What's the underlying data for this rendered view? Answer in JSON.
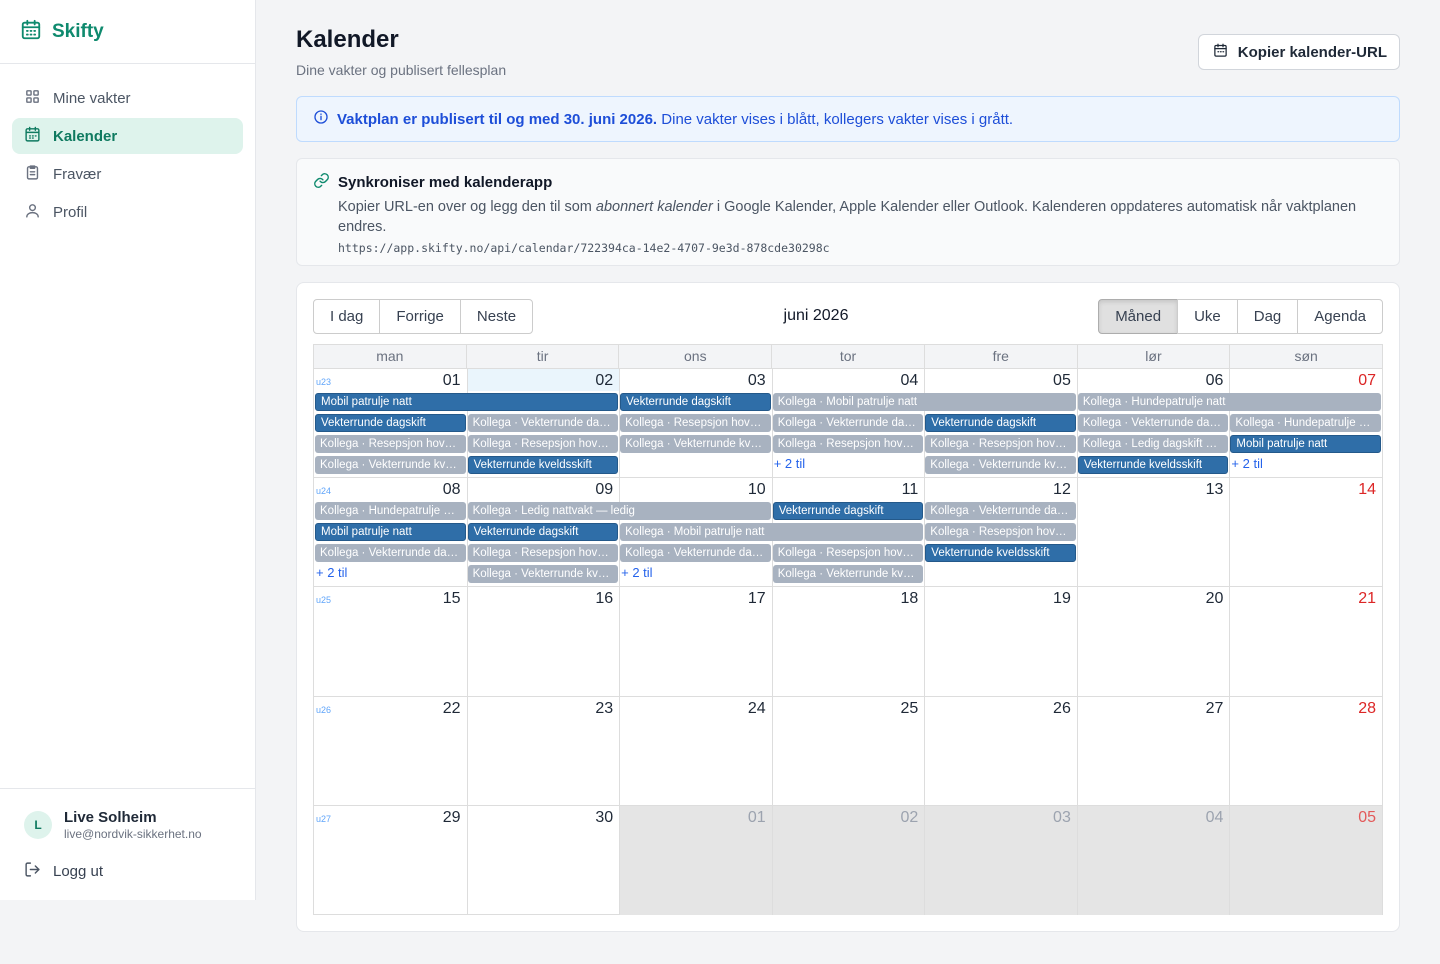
{
  "app": {
    "name": "Skifty"
  },
  "nav": [
    {
      "label": "Mine vakter",
      "icon": "grid-icon",
      "active": false
    },
    {
      "label": "Kalender",
      "icon": "calendar-icon",
      "active": true
    },
    {
      "label": "Fravær",
      "icon": "clipboard-icon",
      "active": false
    },
    {
      "label": "Profil",
      "icon": "user-icon",
      "active": false
    }
  ],
  "user": {
    "initial": "L",
    "name": "Live Solheim",
    "email": "live@nordvik-sikkerhet.no",
    "logout_label": "Logg ut"
  },
  "header": {
    "title": "Kalender",
    "subtitle": "Dine vakter og publisert fellesplan",
    "copy_button": "Kopier kalender-URL"
  },
  "info": {
    "bold": "Vaktplan er publisert til og med 30. juni 2026.",
    "text": " Dine vakter vises i blått, kollegers vakter vises i grått."
  },
  "sync": {
    "title": "Synkroniser med kalenderapp",
    "text_before": "Kopier URL-en over og legg den til som ",
    "text_em": "abonnert kalender",
    "text_after": " i Google Kalender, Apple Kalender eller Outlook. Kalenderen oppdateres automatisk når vaktplanen endres.",
    "url": "https://app.skifty.no/api/calendar/722394ca-14e2-4707-9e3d-878cde30298c"
  },
  "toolbar": {
    "nav_buttons": [
      "I dag",
      "Forrige",
      "Neste"
    ],
    "title": "juni 2026",
    "view_buttons": [
      "Måned",
      "Uke",
      "Dag",
      "Agenda"
    ],
    "active_view": "Måned"
  },
  "weekdays": [
    "man",
    "tir",
    "ons",
    "tor",
    "fre",
    "lør",
    "søn"
  ],
  "colors": {
    "own": "#2f6ea8",
    "colleague": "#a8b2c0",
    "brand": "#0f8a6e"
  },
  "weeks": [
    {
      "week": "u23",
      "days": [
        {
          "n": "01"
        },
        {
          "n": "02",
          "today": true
        },
        {
          "n": "03"
        },
        {
          "n": "04"
        },
        {
          "n": "05"
        },
        {
          "n": "06"
        },
        {
          "n": "07",
          "sun": true
        }
      ],
      "events": [
        {
          "row": 0,
          "start": 0,
          "span": 2,
          "type": "own",
          "label": "Mobil patrulje natt"
        },
        {
          "row": 0,
          "start": 2,
          "span": 1,
          "type": "own",
          "label": "Vekterrunde dagskift"
        },
        {
          "row": 0,
          "start": 3,
          "span": 2,
          "type": "col",
          "label": "Kollega · Mobil patrulje natt"
        },
        {
          "row": 0,
          "start": 5,
          "span": 2,
          "type": "col",
          "label": "Kollega · Hundepatrulje natt"
        },
        {
          "row": 1,
          "start": 0,
          "span": 1,
          "type": "own",
          "label": "Vekterrunde dagskift"
        },
        {
          "row": 1,
          "start": 1,
          "span": 1,
          "type": "col",
          "label": "Kollega · Vekterrunde dagskift"
        },
        {
          "row": 1,
          "start": 2,
          "span": 1,
          "type": "col",
          "label": "Kollega · Resepsjon hovedkontor"
        },
        {
          "row": 1,
          "start": 3,
          "span": 1,
          "type": "col",
          "label": "Kollega · Vekterrunde dagskift"
        },
        {
          "row": 1,
          "start": 4,
          "span": 1,
          "type": "own",
          "label": "Vekterrunde dagskift"
        },
        {
          "row": 1,
          "start": 5,
          "span": 1,
          "type": "col",
          "label": "Kollega · Vekterrunde dagskift"
        },
        {
          "row": 1,
          "start": 6,
          "span": 1,
          "type": "col",
          "label": "Kollega · Hundepatrulje natt"
        },
        {
          "row": 2,
          "start": 0,
          "span": 1,
          "type": "col",
          "label": "Kollega · Resepsjon hovedkontor"
        },
        {
          "row": 2,
          "start": 1,
          "span": 1,
          "type": "col",
          "label": "Kollega · Resepsjon hovedkontor"
        },
        {
          "row": 2,
          "start": 2,
          "span": 1,
          "type": "col",
          "label": "Kollega · Vekterrunde kveldsskift"
        },
        {
          "row": 2,
          "start": 3,
          "span": 1,
          "type": "col",
          "label": "Kollega · Resepsjon hovedkontor"
        },
        {
          "row": 2,
          "start": 4,
          "span": 1,
          "type": "col",
          "label": "Kollega · Resepsjon hovedkontor"
        },
        {
          "row": 2,
          "start": 5,
          "span": 1,
          "type": "col",
          "label": "Kollega · Ledig dagskift — ledig"
        },
        {
          "row": 2,
          "start": 6,
          "span": 1,
          "type": "own",
          "label": "Mobil patrulje natt"
        },
        {
          "row": 3,
          "start": 0,
          "span": 1,
          "type": "col",
          "label": "Kollega · Vekterrunde kveldsskift"
        },
        {
          "row": 3,
          "start": 1,
          "span": 1,
          "type": "own",
          "label": "Vekterrunde kveldsskift"
        },
        {
          "row": 3,
          "start": 4,
          "span": 1,
          "type": "col",
          "label": "Kollega · Vekterrunde kveldsskift"
        },
        {
          "row": 3,
          "start": 5,
          "span": 1,
          "type": "own",
          "label": "Vekterrunde kveldsskift"
        }
      ],
      "more": [
        {
          "day": 3,
          "row": 3,
          "label": "+ 2 til"
        },
        {
          "day": 6,
          "row": 3,
          "label": "+ 2 til"
        }
      ]
    },
    {
      "week": "u24",
      "days": [
        {
          "n": "08"
        },
        {
          "n": "09"
        },
        {
          "n": "10"
        },
        {
          "n": "11"
        },
        {
          "n": "12"
        },
        {
          "n": "13"
        },
        {
          "n": "14",
          "sun": true
        }
      ],
      "events": [
        {
          "row": 0,
          "start": 0,
          "span": 1,
          "type": "col",
          "label": "Kollega · Hundepatrulje natt"
        },
        {
          "row": 0,
          "start": 1,
          "span": 2,
          "type": "col",
          "label": "Kollega · Ledig nattvakt — ledig"
        },
        {
          "row": 0,
          "start": 3,
          "span": 1,
          "type": "own",
          "label": "Vekterrunde dagskift"
        },
        {
          "row": 0,
          "start": 4,
          "span": 1,
          "type": "col",
          "label": "Kollega · Vekterrunde dagskift"
        },
        {
          "row": 1,
          "start": 0,
          "span": 1,
          "type": "own",
          "label": "Mobil patrulje natt"
        },
        {
          "row": 1,
          "start": 1,
          "span": 1,
          "type": "own",
          "label": "Vekterrunde dagskift"
        },
        {
          "row": 1,
          "start": 2,
          "span": 2,
          "type": "col",
          "label": "Kollega · Mobil patrulje natt"
        },
        {
          "row": 1,
          "start": 4,
          "span": 1,
          "type": "col",
          "label": "Kollega · Resepsjon hovedkontor"
        },
        {
          "row": 2,
          "start": 0,
          "span": 1,
          "type": "col",
          "label": "Kollega · Vekterrunde dagskift"
        },
        {
          "row": 2,
          "start": 1,
          "span": 1,
          "type": "col",
          "label": "Kollega · Resepsjon hovedkontor"
        },
        {
          "row": 2,
          "start": 2,
          "span": 1,
          "type": "col",
          "label": "Kollega · Vekterrunde dagskift"
        },
        {
          "row": 2,
          "start": 3,
          "span": 1,
          "type": "col",
          "label": "Kollega · Resepsjon hovedkontor"
        },
        {
          "row": 2,
          "start": 4,
          "span": 1,
          "type": "own",
          "label": "Vekterrunde kveldsskift"
        },
        {
          "row": 3,
          "start": 1,
          "span": 1,
          "type": "col",
          "label": "Kollega · Vekterrunde kveldsskift"
        },
        {
          "row": 3,
          "start": 3,
          "span": 1,
          "type": "col",
          "label": "Kollega · Vekterrunde kveldsskift"
        }
      ],
      "more": [
        {
          "day": 0,
          "row": 3,
          "label": "+ 2 til"
        },
        {
          "day": 2,
          "row": 3,
          "label": "+ 2 til"
        }
      ]
    },
    {
      "week": "u25",
      "days": [
        {
          "n": "15"
        },
        {
          "n": "16"
        },
        {
          "n": "17"
        },
        {
          "n": "18"
        },
        {
          "n": "19"
        },
        {
          "n": "20"
        },
        {
          "n": "21",
          "sun": true
        }
      ],
      "events": [],
      "more": []
    },
    {
      "week": "u26",
      "days": [
        {
          "n": "22"
        },
        {
          "n": "23"
        },
        {
          "n": "24"
        },
        {
          "n": "25"
        },
        {
          "n": "26"
        },
        {
          "n": "27"
        },
        {
          "n": "28",
          "sun": true
        }
      ],
      "events": [],
      "more": []
    },
    {
      "week": "u27",
      "days": [
        {
          "n": "29"
        },
        {
          "n": "30"
        },
        {
          "n": "01",
          "off": true
        },
        {
          "n": "02",
          "off": true
        },
        {
          "n": "03",
          "off": true
        },
        {
          "n": "04",
          "off": true
        },
        {
          "n": "05",
          "off": true,
          "sun": true
        }
      ],
      "events": [],
      "more": []
    }
  ]
}
